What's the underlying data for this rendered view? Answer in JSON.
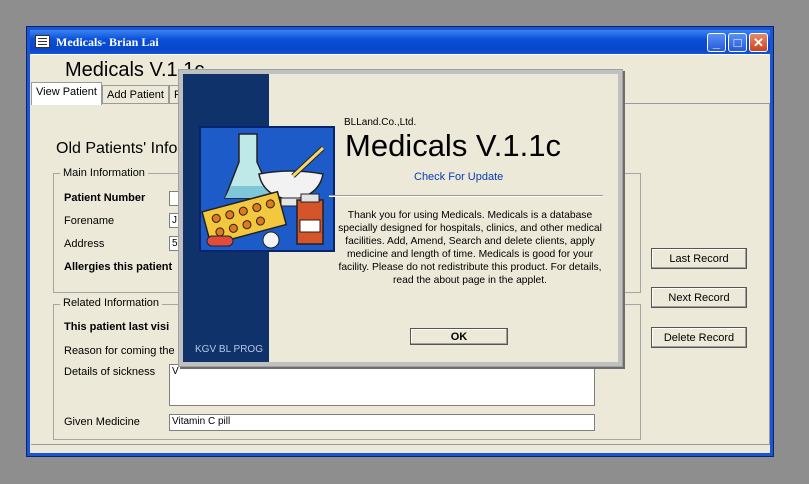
{
  "window": {
    "title": "Medicals- Brian Lai",
    "controls": [
      "minimize-icon",
      "maximize-icon",
      "close-icon"
    ]
  },
  "app": {
    "title": "Medicals V.1.1c",
    "tabs": [
      {
        "label": "View Patient",
        "active": true
      },
      {
        "label": "Add Patient",
        "active": false
      },
      {
        "label": "F",
        "active": false
      }
    ],
    "section_title": "Old Patients' Info",
    "main_info": {
      "legend": "Main Information",
      "patient_number_label": "Patient Number",
      "forename_label": "Forename",
      "forename_value": "J",
      "address_label": "Address",
      "address_value": "5",
      "allergies_label": "Allergies this patient"
    },
    "related_info": {
      "legend": "Related Information",
      "last_visit_label": "This patient last visi",
      "reason_label": "Reason for coming the la",
      "details_label": "Details of sickness",
      "details_value": "V",
      "given_medicine_label": "Given Medicine",
      "given_medicine_value": "Vitamin C pill"
    },
    "buttons": {
      "last_record": "Last Record",
      "next_record": "Next Record",
      "delete_record": "Delete Record"
    }
  },
  "splash": {
    "company": "BLLand.Co.,Ltd.",
    "product": "Medicals V.1.1c",
    "update_link": "Check For Update",
    "message": "Thank you for using Medicals. Medicals is a database specially designed for hospitals, clinics, and other medical facilities. Add, Amend, Search and delete clients, apply medicine and length of time. Medicals is good for your facility. Please do not redistribute this product. For details, read the about page in the applet.",
    "ok_label": "OK",
    "band_label": "KGV BL PROG"
  },
  "colors": {
    "titlebar": "#0a4fd8",
    "splash_band": "#0e3269",
    "link": "#0a3cb4",
    "window_bg": "#ece9d8"
  }
}
